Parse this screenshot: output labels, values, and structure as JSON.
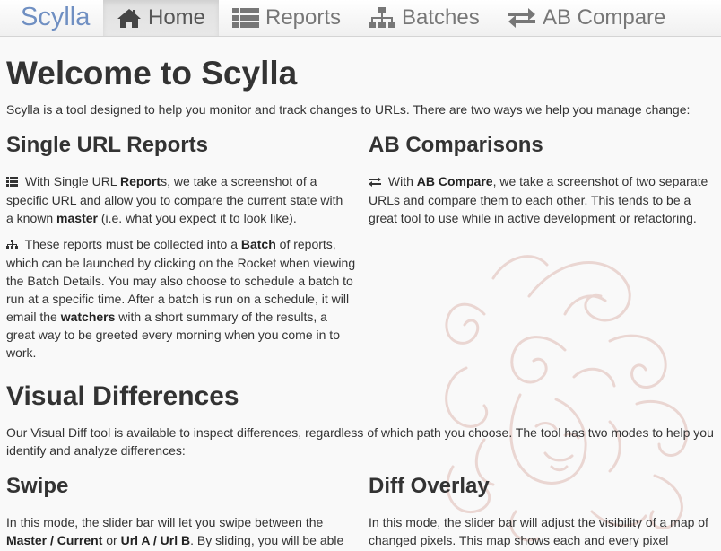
{
  "nav": {
    "brand": "Scylla",
    "items": [
      {
        "label": "Home",
        "icon": "home-icon",
        "active": true
      },
      {
        "label": "Reports",
        "icon": "list-icon",
        "active": false
      },
      {
        "label": "Batches",
        "icon": "sitemap-icon",
        "active": false
      },
      {
        "label": "AB Compare",
        "icon": "exchange-icon",
        "active": false
      }
    ]
  },
  "page": {
    "title": "Welcome to Scylla",
    "intro": "Scylla is a tool designed to help you monitor and track changes to URLs. There are two ways we help you manage change:",
    "single": {
      "heading": "Single URL Reports",
      "p1_a": " With Single URL ",
      "p1_b": "Report",
      "p1_c": "s, we take a screenshot of a specific URL and allow you to compare the current state with a known ",
      "p1_d": "master",
      "p1_e": " (i.e. what you expect it to look like).",
      "p2_a": " These reports must be collected into a ",
      "p2_b": "Batch",
      "p2_c": " of reports, which can be launched by clicking on the Rocket when viewing the Batch Details. You may also choose to schedule a batch to run at a specific time. After a batch is run on a schedule, it will email the ",
      "p2_d": "watchers",
      "p2_e": " with a short summary of the results, a great way to be greeted every morning when you come in to work."
    },
    "ab": {
      "heading": "AB Comparisons",
      "p_a": " With ",
      "p_b": "AB Compare",
      "p_c": ", we take a screenshot of two separate URLs and compare them to each other. This tends to be a great tool to use while in active development or refactoring."
    },
    "visual": {
      "heading": "Visual Differences",
      "text": "Our Visual Diff tool is available to inspect differences, regardless of which path you choose. The tool has two modes to help you identify and analyze differences:"
    },
    "swipe": {
      "heading": "Swipe",
      "p_a": "In this mode, the slider bar will let you swipe between the ",
      "p_b": "Master / Current",
      "p_c": " or ",
      "p_d": "Url A / Url B",
      "p_e": ". By sliding, you will be able"
    },
    "overlay": {
      "heading": "Diff Overlay",
      "text": "In this mode, the slider bar will adjust the visibility of a map of changed pixels. This map shows each and every pixel"
    }
  }
}
